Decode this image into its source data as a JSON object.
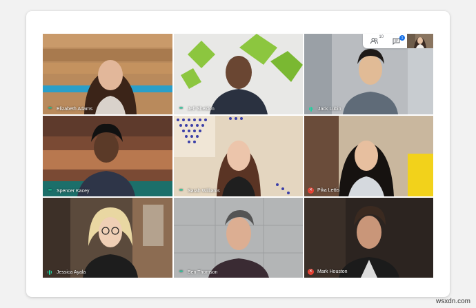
{
  "meeting": {
    "participant_count": "10",
    "chat_unread": "1",
    "participants": [
      {
        "name": "Elizabeth Adams",
        "mic": "talking"
      },
      {
        "name": "Jeff Sheldon",
        "mic": "talking"
      },
      {
        "name": "Jack Lubin",
        "mic": "speaking"
      },
      {
        "name": "Spencer Kacey",
        "mic": "talking"
      },
      {
        "name": "Sarah Williams",
        "mic": "talking"
      },
      {
        "name": "Pika Lettis",
        "mic": "muted"
      },
      {
        "name": "Jessica Ayala",
        "mic": "speaking"
      },
      {
        "name": "Ben Thomson",
        "mic": "talking"
      },
      {
        "name": "Mark Houston",
        "mic": "muted"
      }
    ]
  },
  "icons": {
    "people": "people-icon",
    "chat": "chat-icon",
    "mic_muted": "mic-muted-icon"
  },
  "colors": {
    "talking_indicator": "#1fd1a0",
    "muted_indicator": "#ea4335",
    "chat_badge": "#1a73e8"
  },
  "watermark": "wsxdn.com"
}
